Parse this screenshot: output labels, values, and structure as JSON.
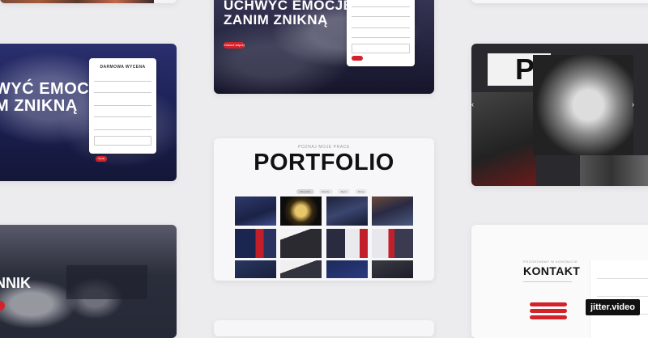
{
  "hero_top": {
    "title_line1": "UCHWYĆ EMOCJE,",
    "title_line2": "ZANIM ZNIKNĄ",
    "cta": "Zobacz więcej"
  },
  "hero_left": {
    "title_line1": "WYĆ EMOCJE,",
    "title_line2": "M ZNIKNĄ",
    "form_title": "DARMOWA WYCENA",
    "submit": "Wyślij"
  },
  "portfolio": {
    "eyebrow": "POZNAJ MOJE PRACE",
    "title": "PORTFOLIO",
    "filters": [
      "Wszystkie",
      "Eventy",
      "Sport",
      "Firmy"
    ]
  },
  "kontakt": {
    "eyebrow": "POZOSTAŃMY W KONTAKCIE",
    "title": "KONTAKT"
  },
  "judo": {
    "title_fragment": "NNIK"
  },
  "watermark": "jitter.video",
  "icons": {
    "slider_prev": "chevron-left-icon",
    "slider_next": "chevron-right-icon"
  },
  "colors": {
    "accent": "#d3222a",
    "background": "#ececee"
  }
}
